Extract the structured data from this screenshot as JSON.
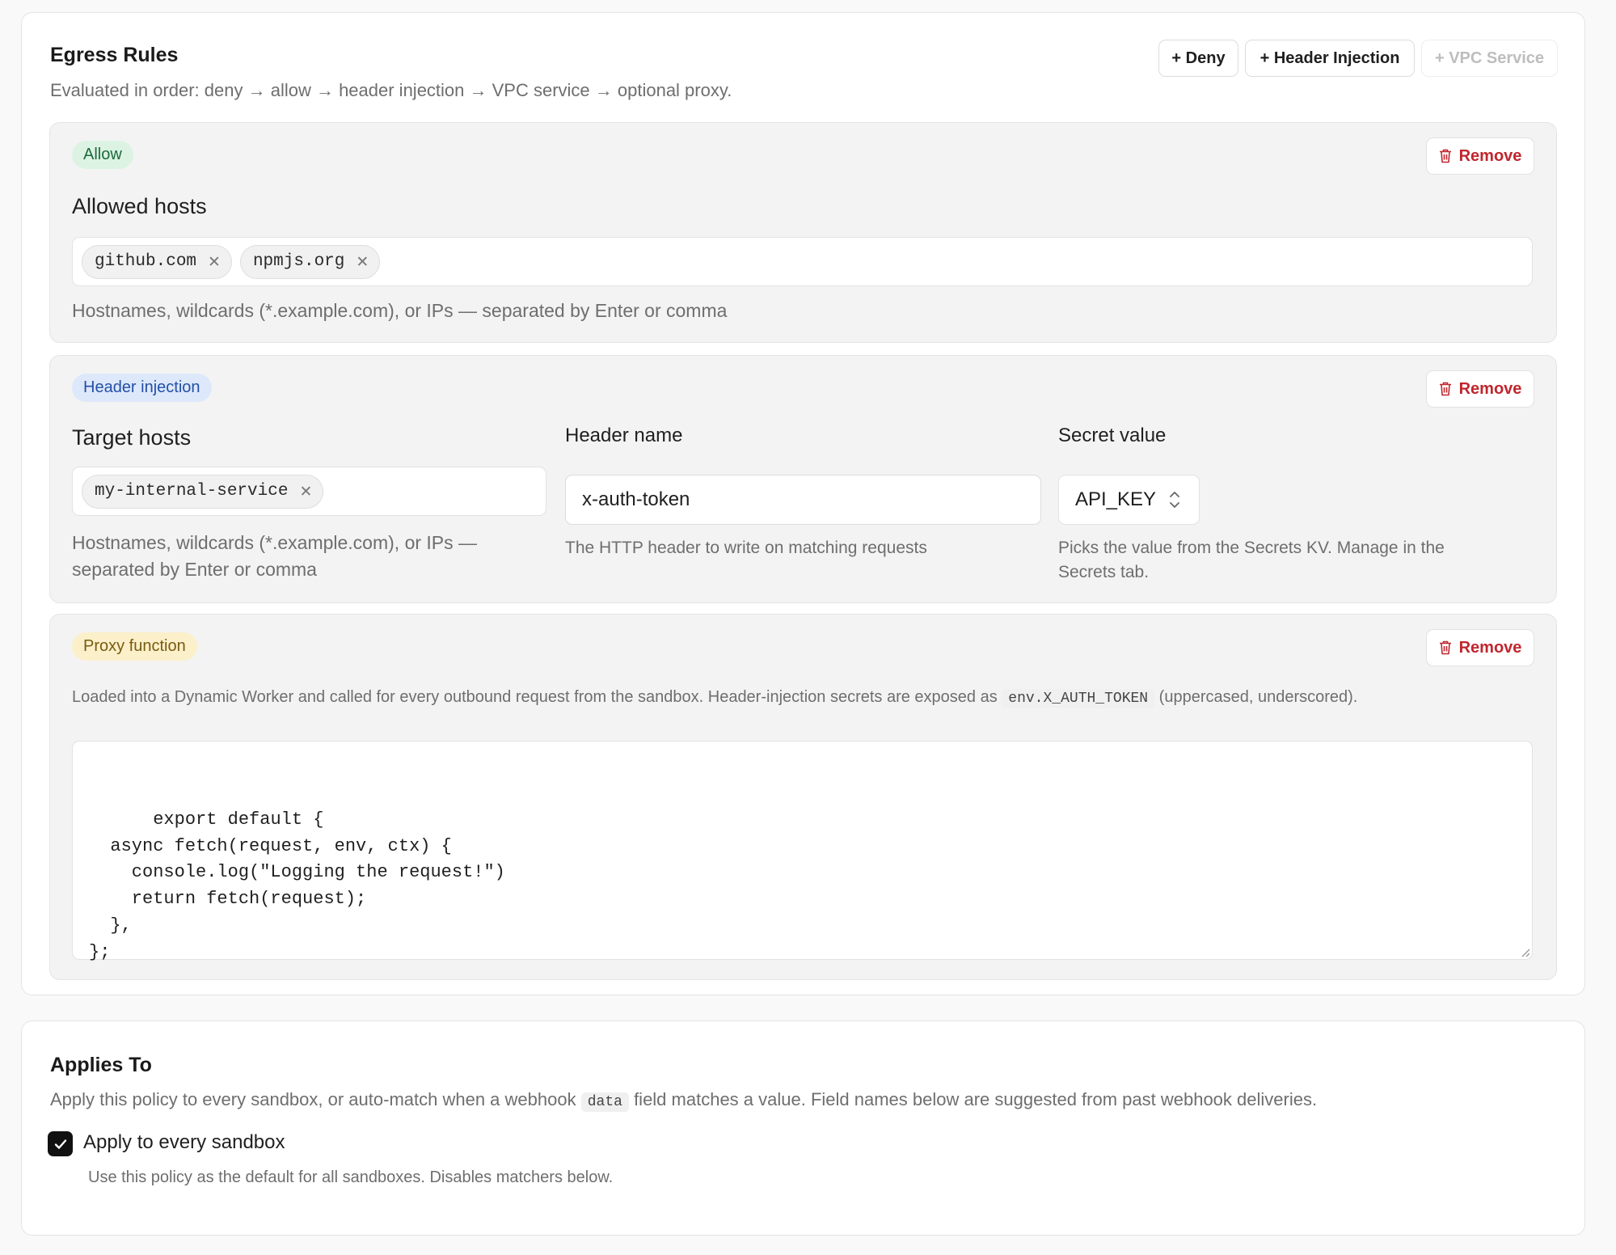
{
  "egress": {
    "title": "Egress Rules",
    "subtitle": "Evaluated in order: deny → allow → header injection → VPC service → optional proxy.",
    "buttons": {
      "deny": "+ Deny",
      "header_injection": "+ Header Injection",
      "vpc_service": "+ VPC Service"
    },
    "remove_label": "Remove",
    "allow_rule": {
      "badge": "Allow",
      "label": "Allowed hosts",
      "hosts": [
        "github.com",
        "npmjs.org"
      ],
      "help": "Hostnames, wildcards (*.example.com), or IPs — separated by Enter or comma"
    },
    "header_rule": {
      "badge": "Header injection",
      "target_label": "Target hosts",
      "hosts": [
        "my-internal-service"
      ],
      "target_help_line1": "Hostnames, wildcards (*.example.com), or IPs —",
      "target_help_line2": "separated by Enter or comma",
      "header_name_label": "Header name",
      "header_name_value": "x-auth-token",
      "header_name_help": "The HTTP header to write on matching requests",
      "secret_label": "Secret value",
      "secret_value": "API_KEY",
      "secret_help_line1": "Picks the value from the Secrets KV. Manage in the",
      "secret_help_line2": "Secrets tab."
    },
    "proxy_rule": {
      "badge": "Proxy function",
      "desc_before": "Loaded into a Dynamic Worker and called for every outbound request from the sandbox. Header-injection secrets are exposed as",
      "desc_code": "env.X_AUTH_TOKEN",
      "desc_after": "(uppercased, underscored).",
      "code": "export default {\n  async fetch(request, env, ctx) {\n    console.log(\"Logging the request!\")\n    return fetch(request);\n  },\n};"
    }
  },
  "applies": {
    "title": "Applies To",
    "desc_before": "Apply this policy to every sandbox, or auto-match when a webhook",
    "desc_code": "data",
    "desc_after": "field matches a value. Field names below are suggested from past webhook deliveries.",
    "checkbox_label": "Apply to every sandbox",
    "checkbox_checked": true,
    "checkbox_help": "Use this policy as the default for all sandboxes. Disables matchers below."
  },
  "colors": {
    "allow_badge_bg": "#dcf3e4",
    "allow_badge_fg": "#1d6b3a",
    "header_badge_bg": "#dde8fb",
    "header_badge_fg": "#2450a6",
    "proxy_badge_bg": "#fbf0c9",
    "proxy_badge_fg": "#7a5a10",
    "remove_fg": "#c0262d"
  },
  "icons": {
    "remove": "trash-icon",
    "chip_remove": "close-icon",
    "select": "chevron-up-down-icon",
    "checkbox": "check-icon"
  }
}
